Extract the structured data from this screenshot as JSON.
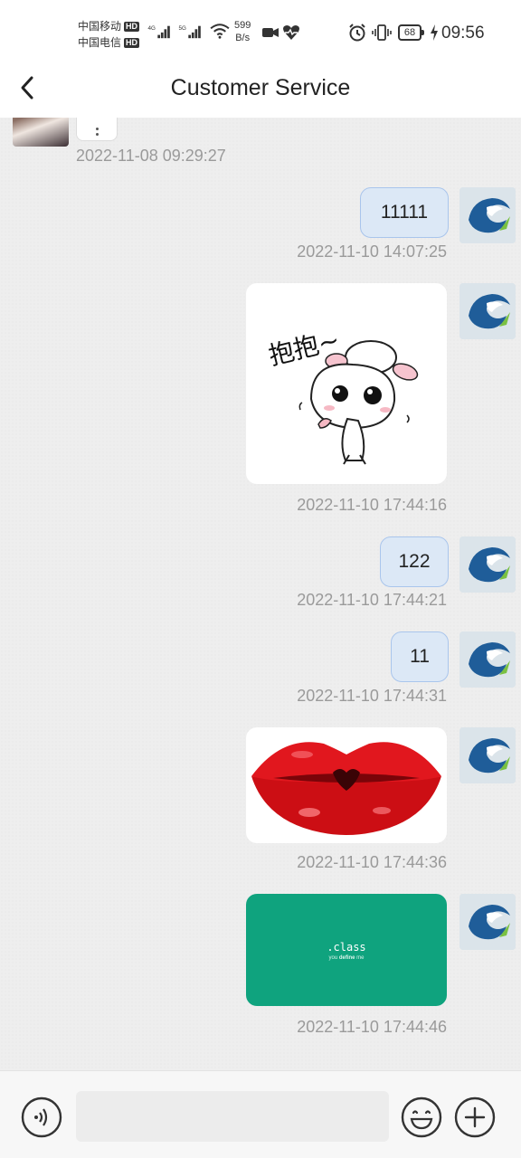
{
  "status_bar": {
    "carrier_1": "中国移动",
    "carrier_2": "中国电信",
    "hd_badge": "HD",
    "net_1": "4G",
    "net_2": "5G",
    "speed_value": "599",
    "speed_unit": "B/s",
    "battery": "68",
    "time": "09:56"
  },
  "header": {
    "title": "Customer Service",
    "back_icon": "chevron-left-icon"
  },
  "messages": [
    {
      "sender": "peer",
      "type": "text",
      "timestamp": "2022-11-08 09:29:27"
    },
    {
      "sender": "me",
      "type": "text",
      "text": "11111",
      "timestamp": "2022-11-10 14:07:25"
    },
    {
      "sender": "me",
      "type": "sticker",
      "sticker_text": "抱抱~",
      "timestamp": "2022-11-10 17:44:16"
    },
    {
      "sender": "me",
      "type": "text",
      "text": "122",
      "timestamp": "2022-11-10 17:44:21"
    },
    {
      "sender": "me",
      "type": "text",
      "text": "11",
      "timestamp": "2022-11-10 17:44:31"
    },
    {
      "sender": "me",
      "type": "sticker",
      "timestamp": "2022-11-10 17:44:36"
    },
    {
      "sender": "me",
      "type": "image",
      "image_title": ".class",
      "image_sub_1": "you ",
      "image_sub_bold": "define",
      "image_sub_2": " me",
      "timestamp": "2022-11-10 17:44:46"
    }
  ],
  "input_bar": {
    "voice_icon": "voice-icon",
    "input_value": "",
    "emoji_icon": "smiley-icon",
    "plus_icon": "plus-icon"
  },
  "colors": {
    "bubble_bg": "#dce8f6",
    "bubble_border": "#a9c5ec",
    "image_green": "#0fa37e",
    "timestamp": "#9a9a9a"
  }
}
